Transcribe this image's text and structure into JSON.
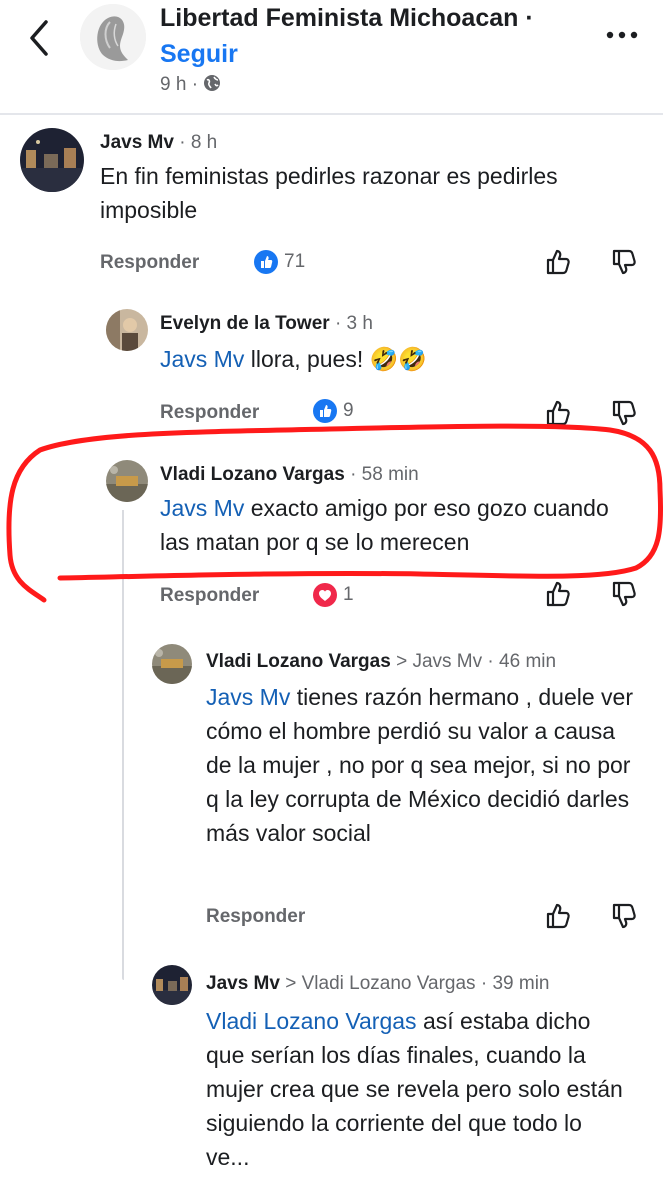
{
  "header": {
    "page_name": "Libertad Feminista Michoacan ·",
    "follow_label": "Seguir",
    "age": "9 h ·"
  },
  "comments": [
    {
      "author": "Javs Mv",
      "time": "· 8 h",
      "text": "En fin feministas pedirles razonar es pedirles imposible",
      "reply_label": "Responder",
      "reaction_count": "71"
    },
    {
      "author": "Evelyn de la Tower",
      "time": "· 3 h",
      "mention": "Javs Mv",
      "text": " llora, pues! 🤣🤣",
      "reply_label": "Responder",
      "reaction_count": "9"
    },
    {
      "author": "Vladi Lozano Vargas",
      "time": "· 58 min",
      "mention": "Javs Mv",
      "text": " exacto amigo por eso gozo cuando las matan por q se lo merecen",
      "reply_label": "Responder",
      "reaction_count": "1"
    },
    {
      "author": "Vladi Lozano Vargas",
      "reply_arrow": ">",
      "reply_target": "Javs Mv",
      "time": "· 46 min",
      "mention": "Javs Mv",
      "text": " tienes razón hermano , duele ver cómo el hombre perdió su valor a causa de la mujer , no por q sea mejor, si no por q la ley corrupta de México decidió darles más valor social",
      "reply_label": "Responder"
    },
    {
      "author": "Javs Mv",
      "reply_arrow": ">",
      "reply_target": "Vladi Lozano Vargas",
      "time": "· 39 min",
      "mention": "Vladi Lozano Vargas",
      "text": " así estaba dicho que serían los días finales, cuando la mujer crea que se revela pero solo están siguiendo la corriente del que todo lo ve..."
    }
  ],
  "colors": {
    "link_blue": "#1877f2",
    "mention_blue": "#1460b5",
    "muted": "#65676b",
    "highlight_red": "#ff1a1a"
  }
}
